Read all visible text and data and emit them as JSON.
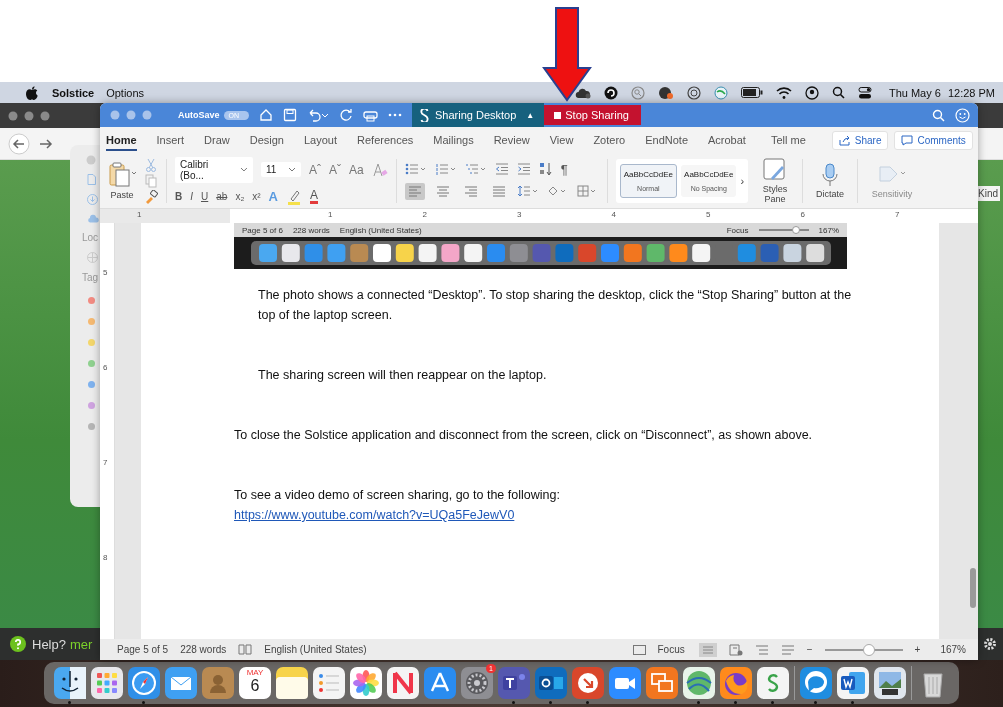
{
  "menu_bar": {
    "app": "Solstice",
    "menus": [
      "Options"
    ],
    "date": "Thu May 6",
    "time": "12:28 PM"
  },
  "background_window": {
    "locations_label": "Loc",
    "tags_label": "Tag",
    "tags": [
      {
        "color": "#f28b82"
      },
      {
        "color": "#f5b971"
      },
      {
        "color": "#f3d66b"
      },
      {
        "color": "#8fd18f"
      },
      {
        "color": "#7fb2ee"
      },
      {
        "color": "#cfa3e0"
      },
      {
        "color": "#b5b5b5"
      }
    ],
    "column_label": "Kind",
    "help": "Help?",
    "help_link": "mer"
  },
  "word": {
    "autosave": {
      "label": "AutoSave",
      "state": "ON",
      "on": true
    },
    "sharing": {
      "label": "Sharing Desktop",
      "caret": "▲"
    },
    "stop_button": "Stop Sharing",
    "tabs": [
      {
        "label": "Home",
        "selected": true
      },
      {
        "label": "Insert",
        "selected": false
      },
      {
        "label": "Draw",
        "selected": false
      },
      {
        "label": "Design",
        "selected": false
      },
      {
        "label": "Layout",
        "selected": false
      },
      {
        "label": "References",
        "selected": false
      },
      {
        "label": "Mailings",
        "selected": false
      },
      {
        "label": "Review",
        "selected": false
      },
      {
        "label": "View",
        "selected": false
      },
      {
        "label": "Zotero",
        "selected": false
      },
      {
        "label": "EndNote",
        "selected": false
      },
      {
        "label": "Acrobat",
        "selected": false
      }
    ],
    "tell_me": "Tell me",
    "share": "Share",
    "comments": "Comments",
    "paste": "Paste",
    "font": {
      "name": "Calibri (Bo...",
      "size": "11"
    },
    "font_tools": [
      "Aˆ",
      "Aˇ",
      "Aa"
    ],
    "font_buttons": [
      "B",
      "I",
      "U",
      "ab",
      "x₂",
      "x²"
    ],
    "color_buttons": [
      {
        "kind": "effects",
        "label": "A"
      },
      {
        "kind": "highlight"
      },
      {
        "kind": "fontcolor",
        "label": "A"
      }
    ],
    "alignments": [
      {
        "selected": true
      },
      {
        "selected": false
      },
      {
        "selected": false
      },
      {
        "selected": false
      }
    ],
    "pilcrow": "¶",
    "styles": [
      {
        "preview": "AaBbCcDdEe",
        "name": "Normal",
        "selected": true
      },
      {
        "preview": "AaBbCcDdEe",
        "name": "No Spacing",
        "selected": false
      }
    ],
    "styles_more": "›",
    "styles_pane": "Styles Pane",
    "dictate": "Dictate",
    "sensitivity": {
      "label": "Sensitivity",
      "disabled": true
    },
    "ruler": [
      "1",
      "1",
      "2",
      "3",
      "4",
      "5",
      "6",
      "7"
    ],
    "vertical_ruler": [
      "5",
      "6",
      "7",
      "8"
    ],
    "document": {
      "screenshot": {
        "page": "Page 5 of 6",
        "words": "228 words",
        "language": "English (United States)",
        "focus": "Focus",
        "zoom_slider": {
          "level": 0.75
        },
        "zoom": "167%"
      },
      "paragraphs": [
        {
          "kind": "indented",
          "text": "The photo shows a connected “Desktop”.  To stop sharing the desktop, click the “Stop Sharing” button at the top of the laptop screen."
        },
        {
          "kind": "indented",
          "text": "The sharing screen will then reappear on the laptop."
        },
        {
          "kind": "plain",
          "text": "To close the Solstice application and disconnect from the screen, click on “Disconnect”, as shown above."
        },
        {
          "kind": "plain",
          "text": "To see a video demo of screen sharing, go to the following:",
          "link": "https://www.youtube.com/watch?v=UQa5FeJewV0"
        }
      ]
    },
    "status_bar": {
      "page": "Page 5 of 5",
      "words": "228 words",
      "language": "English (United States)",
      "focus": "Focus",
      "minus": "−",
      "plus": "+",
      "zoom": {
        "level": 0.57
      },
      "zoom_reading": "167%"
    }
  },
  "dock": [
    {
      "kind": "finder",
      "running": true
    },
    {
      "kind": "launchpad",
      "running": false
    },
    {
      "kind": "browser",
      "running": true
    },
    {
      "kind": "mail",
      "running": false
    },
    {
      "kind": "contacts",
      "running": false
    },
    {
      "kind": "calendar",
      "running": false,
      "month": "MAY",
      "day": "6"
    },
    {
      "kind": "notes",
      "running": false
    },
    {
      "kind": "reminders",
      "running": false
    },
    {
      "kind": "photos",
      "running": false
    },
    {
      "kind": "news",
      "running": false
    },
    {
      "kind": "store",
      "running": false
    },
    {
      "kind": "settings",
      "running": false,
      "badge": "1"
    },
    {
      "kind": "chat",
      "running": true
    },
    {
      "kind": "email",
      "running": true
    },
    {
      "kind": "remote",
      "running": true
    },
    {
      "kind": "video",
      "running": false
    },
    {
      "kind": "share",
      "running": false
    },
    {
      "kind": "globe",
      "running": true
    },
    {
      "kind": "firefox",
      "running": true
    },
    {
      "kind": "solstice",
      "running": true
    },
    {
      "kind": "separator"
    },
    {
      "kind": "assistant",
      "running": true
    },
    {
      "kind": "word",
      "running": true
    },
    {
      "kind": "preview",
      "running": false
    },
    {
      "kind": "separator"
    },
    {
      "kind": "trash",
      "running": false
    }
  ]
}
